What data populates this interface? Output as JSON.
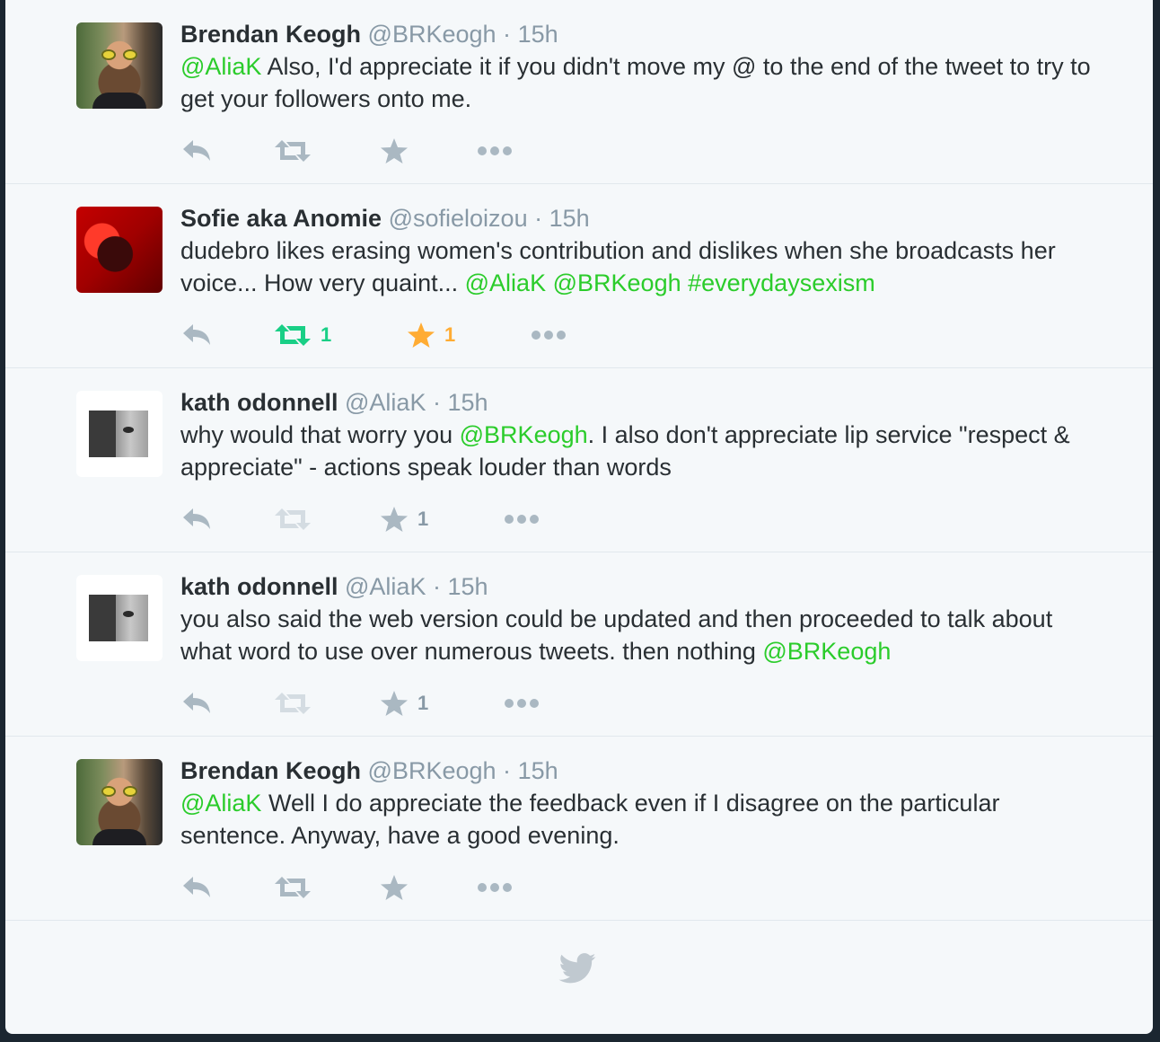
{
  "tweets": [
    {
      "avatar": "brendan",
      "name": "Brendan Keogh",
      "handle": "@BRKeogh",
      "time": "15h",
      "text_segments": [
        {
          "type": "link",
          "text": "@AliaK"
        },
        {
          "type": "text",
          "text": " Also, I'd appreciate it if you didn't move my @ to the end of the tweet to try to get your followers onto me."
        }
      ],
      "retweets": "",
      "favorites": "",
      "retweeted": false,
      "favorited": false
    },
    {
      "avatar": "sofie",
      "name": "Sofie aka Anomie",
      "handle": "@sofieloizou",
      "time": "15h",
      "text_segments": [
        {
          "type": "text",
          "text": "dudebro likes erasing women's contribution and dislikes when she broadcasts her voice... How very quaint... "
        },
        {
          "type": "link",
          "text": "@AliaK"
        },
        {
          "type": "text",
          "text": " "
        },
        {
          "type": "link",
          "text": "@BRKeogh"
        },
        {
          "type": "text",
          "text": " "
        },
        {
          "type": "link",
          "text": "#everydaysexism"
        }
      ],
      "retweets": "1",
      "favorites": "1",
      "retweeted": true,
      "favorited": true
    },
    {
      "avatar": "kath",
      "name": "kath odonnell",
      "handle": "@AliaK",
      "time": "15h",
      "text_segments": [
        {
          "type": "text",
          "text": "why would that worry you "
        },
        {
          "type": "link",
          "text": "@BRKeogh"
        },
        {
          "type": "text",
          "text": ". I also don't appreciate lip service \"respect & appreciate\" - actions speak louder than words"
        }
      ],
      "retweets": "",
      "favorites": "1",
      "retweeted": false,
      "favorited": false,
      "retweet_disabled": true
    },
    {
      "avatar": "kath",
      "name": "kath odonnell",
      "handle": "@AliaK",
      "time": "15h",
      "text_segments": [
        {
          "type": "text",
          "text": "you also said the web version could be updated and then proceeded to talk about what word to use over numerous tweets. then nothing "
        },
        {
          "type": "link",
          "text": "@BRKeogh"
        }
      ],
      "retweets": "",
      "favorites": "1",
      "retweeted": false,
      "favorited": false,
      "retweet_disabled": true
    },
    {
      "avatar": "brendan",
      "name": "Brendan Keogh",
      "handle": "@BRKeogh",
      "time": "15h",
      "text_segments": [
        {
          "type": "link",
          "text": "@AliaK"
        },
        {
          "type": "text",
          "text": " Well I do appreciate the feedback even if I disagree on the particular sentence. Anyway, have a good evening."
        }
      ],
      "retweets": "",
      "favorites": "",
      "retweeted": false,
      "favorited": false
    }
  ],
  "icons": {
    "reply": "reply-icon",
    "retweet": "retweet-icon",
    "favorite": "star-icon",
    "more": "more-icon",
    "footer": "twitter-bird-icon"
  },
  "colors": {
    "link": "#2bcc2b",
    "retweet_active": "#19cf86",
    "favorite_active": "#ffac33",
    "icon": "#aab8c2",
    "muted": "#8899a6",
    "text": "#292f33"
  }
}
